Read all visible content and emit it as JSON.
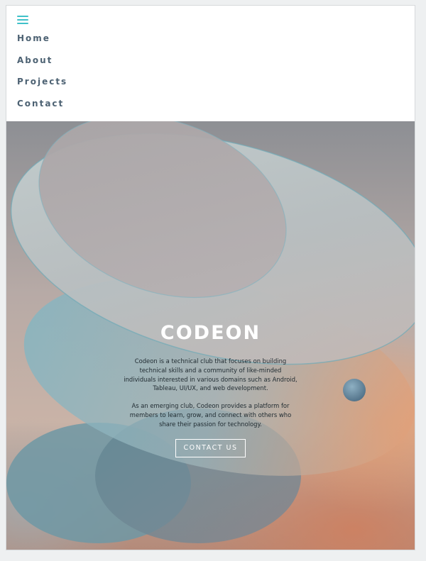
{
  "nav": {
    "menu_icon": "hamburger-icon",
    "accent_color": "#3fc1c9",
    "items": [
      {
        "label": "Home"
      },
      {
        "label": "About"
      },
      {
        "label": "Projects"
      },
      {
        "label": "Contact"
      }
    ]
  },
  "hero": {
    "title": "CODEON",
    "paragraph_1": "Codeon is a technical club that focuses on building technical skills and a community of like-minded individuals interested in various domains such as Android, Tableau, UI/UX, and web development.",
    "paragraph_2": "As an emerging club, Codeon provides a platform for members to learn, grow, and connect with others who share their passion for technology.",
    "cta_label": "CONTACT US"
  }
}
